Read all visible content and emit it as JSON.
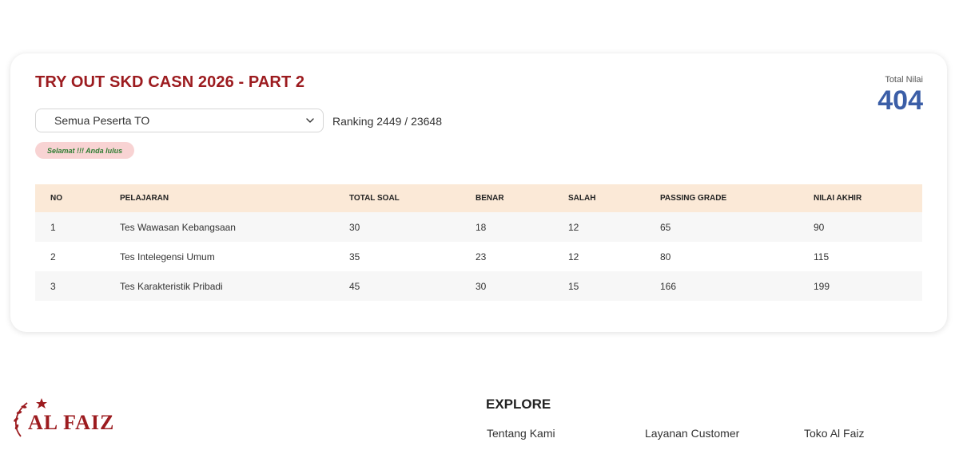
{
  "result": {
    "title": "TRY OUT SKD CASN 2026 - PART 2",
    "total_label": "Total Nilai",
    "total_value": "404",
    "filter": {
      "selected": "Semua Peserta TO"
    },
    "ranking": "Ranking 2449 / 23648",
    "status_badge": "Selamat !!! Anda lulus",
    "table": {
      "headers": [
        "NO",
        "PELAJARAN",
        "TOTAL SOAL",
        "BENAR",
        "SALAH",
        "PASSING GRADE",
        "NILAI AKHIR"
      ],
      "rows": [
        [
          "1",
          "Tes Wawasan Kebangsaan",
          "30",
          "18",
          "12",
          "65",
          "90"
        ],
        [
          "2",
          "Tes Intelegensi Umum",
          "35",
          "23",
          "12",
          "80",
          "115"
        ],
        [
          "3",
          "Tes Karakteristik Pribadi",
          "45",
          "30",
          "15",
          "166",
          "199"
        ]
      ]
    }
  },
  "footer": {
    "logo_text": "AL FAIZ",
    "explore_title": "EXPLORE",
    "links": [
      "Tentang Kami",
      "Layanan Customer",
      "Toko Al Faiz"
    ]
  },
  "colors": {
    "title": "#9c1b1f",
    "total_value": "#3b5ea7",
    "table_header_bg": "#fbe9d7",
    "badge_bg": "#f8d3d3",
    "badge_text": "#2e7d32"
  },
  "icons": {
    "select_chevron": "chevron-down-icon",
    "logo_emblem": "laurel-star-icon"
  }
}
